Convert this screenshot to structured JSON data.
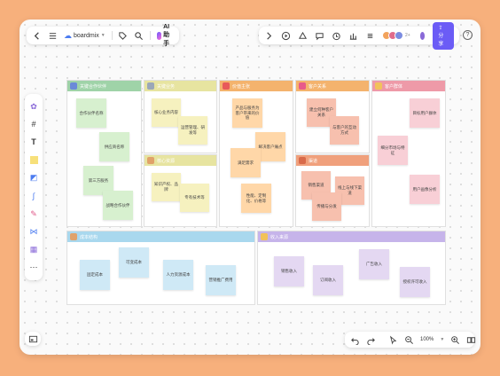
{
  "toolbar_top_left": {
    "brand": "boardmix",
    "ai_label": "AI助手"
  },
  "toolbar_top_right": {
    "share_label": "分享",
    "collaborator_count": "2+",
    "help_label": "?"
  },
  "zoom": {
    "value": "100%"
  },
  "colors": {
    "accent": "#6b5cf6",
    "frame_green": "#9fd3a8",
    "frame_yellow": "#e7e4a0",
    "frame_orange": "#f4b36d",
    "frame_salmon": "#f0a07c",
    "frame_pink": "#ee9aa8",
    "frame_blue": "#a9d8ee",
    "frame_purple": "#c6b4ea"
  },
  "board": {
    "frames": [
      {
        "key": "partners",
        "title": "关键合作伙伴",
        "color": "#9fd3a8",
        "notes": [
          "合作伙伴名称",
          "供应商名称",
          "第三方服务",
          "战略合作伙伴"
        ]
      },
      {
        "key": "activities",
        "title": "关键业务",
        "color": "#e7e4a0",
        "notes": [
          "核心业务内容",
          "运营管理、研发等"
        ]
      },
      {
        "key": "resources",
        "title": "核心资源",
        "color": "#e7e4a0",
        "notes": [
          "知识产权、品牌",
          "专有技术等"
        ]
      },
      {
        "key": "value",
        "title": "价值主张",
        "color": "#f4b36d",
        "notes": [
          "产品与服务为客户带来的价值",
          "解决客户痛点",
          "满足需求",
          "性能、定制化、价格等"
        ]
      },
      {
        "key": "relationships",
        "title": "客户关系",
        "color": "#f4b36d",
        "notes": [
          "建立何种客户关系",
          "与客户的互动方式"
        ]
      },
      {
        "key": "channels",
        "title": "渠道",
        "color": "#f0a07c",
        "notes": [
          "销售渠道",
          "线上与线下渠道",
          "传播与分发"
        ]
      },
      {
        "key": "segments",
        "title": "客户群体",
        "color": "#ee9aa8",
        "notes": [
          "目标用户群体",
          "细分市场与特征",
          "用户画像分析"
        ]
      },
      {
        "key": "costs",
        "title": "成本结构",
        "color": "#a9d8ee",
        "notes": [
          "固定成本",
          "可变成本",
          "人力资源成本",
          "营销推广费用"
        ]
      },
      {
        "key": "revenue",
        "title": "收入来源",
        "color": "#c6b4ea",
        "notes": [
          "销售收入",
          "订阅收入",
          "广告收入",
          "授权许可收入"
        ]
      }
    ]
  }
}
